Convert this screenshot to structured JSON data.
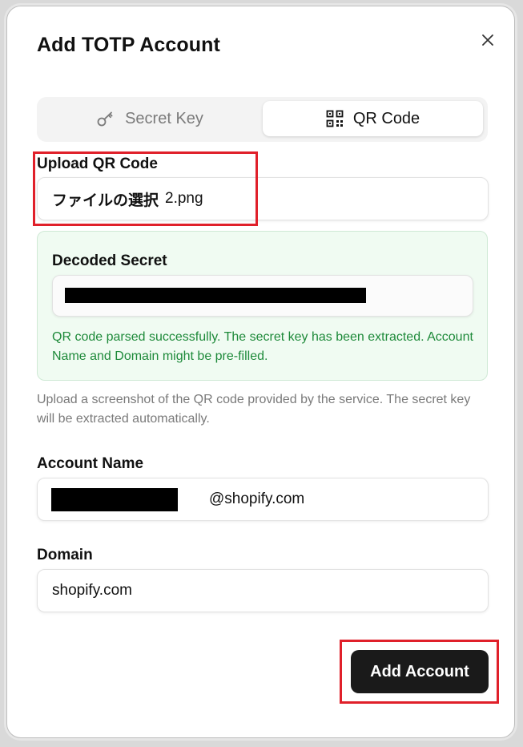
{
  "dialog": {
    "title": "Add TOTP Account",
    "close_icon": "close-icon"
  },
  "tabs": [
    {
      "label": "Secret Key",
      "icon": "key-icon",
      "active": false
    },
    {
      "label": "QR Code",
      "icon": "qr-code-icon",
      "active": true
    }
  ],
  "upload": {
    "label": "Upload QR Code",
    "choose_file_text": "ファイルの選択",
    "file_name": "2.png"
  },
  "decoded": {
    "label": "Decoded Secret",
    "success_message": "QR code parsed successfully. The secret key has been extracted. Account Name and Domain might be pre-filled.",
    "success_color": "#1e8a3a"
  },
  "help_text": "Upload a screenshot of the QR code provided by the service. The secret key will be extracted automatically.",
  "account_name": {
    "label": "Account Name",
    "value_suffix": "@shopify.com"
  },
  "domain": {
    "label": "Domain",
    "value": "shopify.com"
  },
  "actions": {
    "add_label": "Add Account"
  },
  "colors": {
    "highlight": "#e0202a",
    "primary_button": "#1a1a1a"
  }
}
